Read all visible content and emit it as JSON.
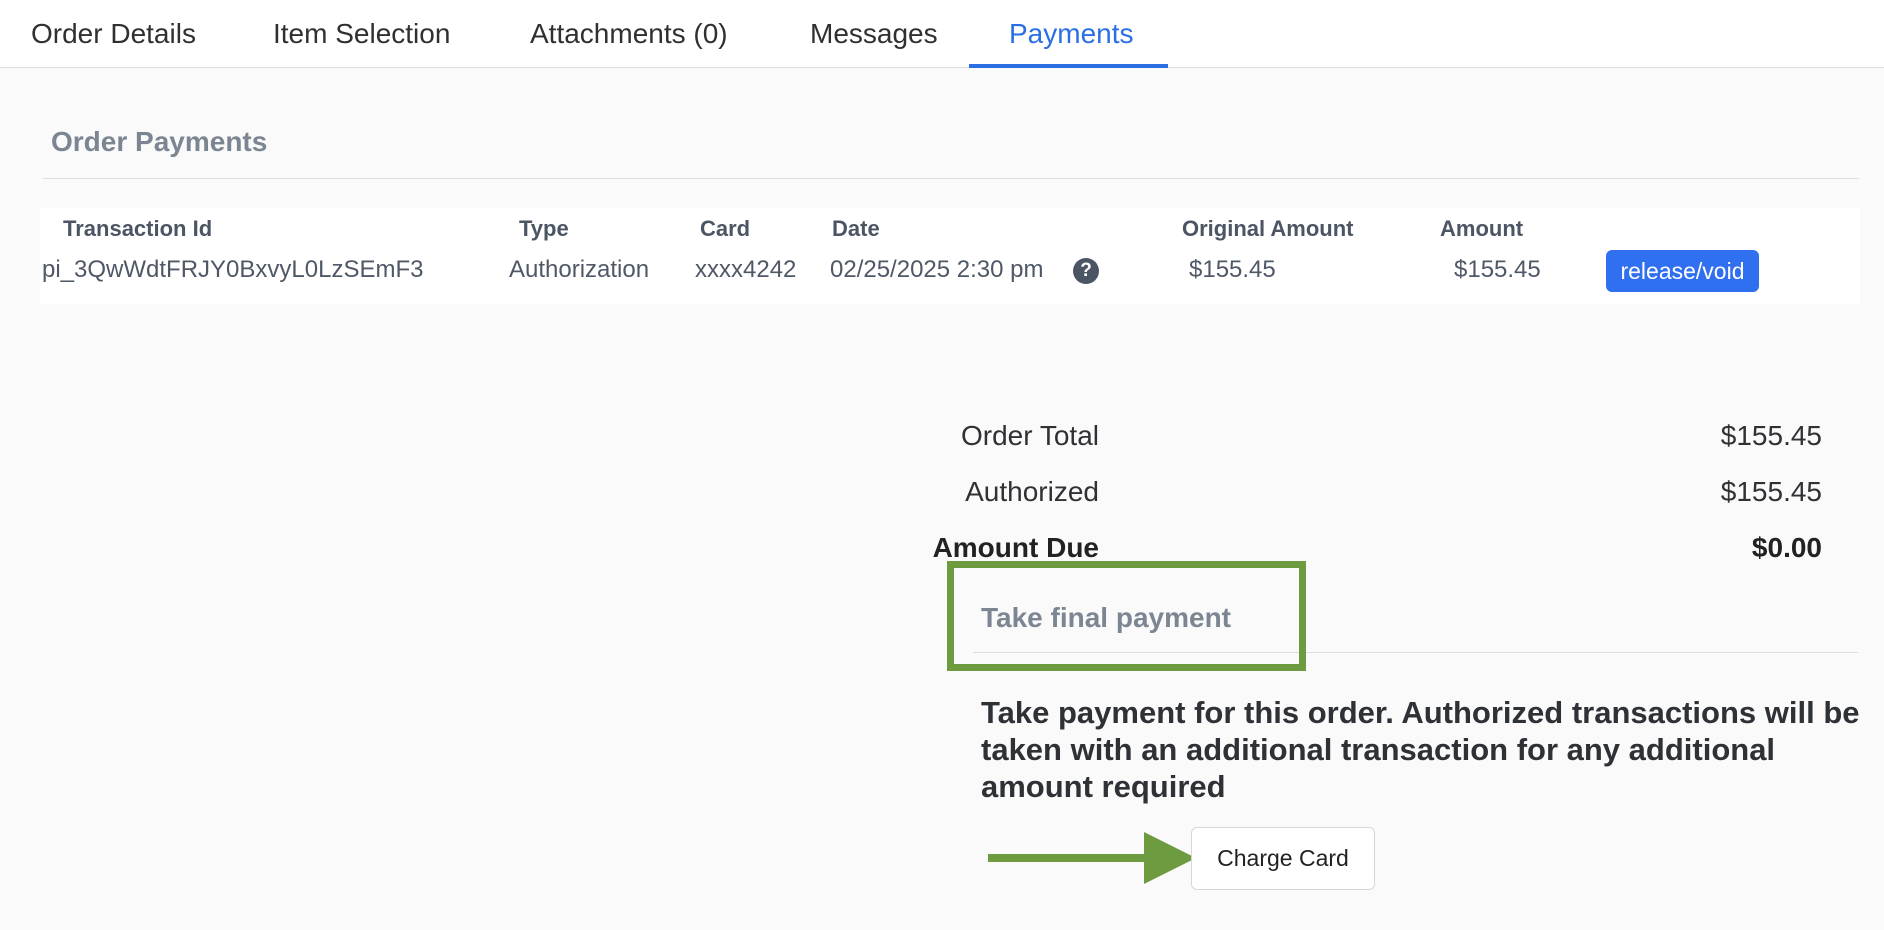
{
  "tabs": [
    {
      "label": "Order Details"
    },
    {
      "label": "Item Selection"
    },
    {
      "label": "Attachments (0)"
    },
    {
      "label": "Messages"
    },
    {
      "label": "Payments"
    }
  ],
  "order_payments": {
    "title": "Order Payments",
    "headers": {
      "transaction_id": "Transaction Id",
      "type": "Type",
      "card": "Card",
      "date": "Date",
      "original_amount": "Original Amount",
      "amount": "Amount"
    },
    "rows": [
      {
        "transaction_id": "pi_3QwWdtFRJY0BxvyL0LzSEmF3",
        "type": "Authorization",
        "card": "xxxx4242",
        "date": "02/25/2025 2:30 pm",
        "help_glyph": "?",
        "original_amount": "$155.45",
        "amount": "$155.45",
        "action_label": "release/void"
      }
    ]
  },
  "totals": {
    "order_total_label": "Order Total",
    "order_total_value": "$155.45",
    "authorized_label": "Authorized",
    "authorized_value": "$155.45",
    "amount_due_label": "Amount Due",
    "amount_due_value": "$0.00"
  },
  "final_payment": {
    "title": "Take final payment",
    "description": "Take payment for this order. Authorized transactions will be taken with an additional transaction for any additional amount required",
    "button_label": "Charge Card"
  },
  "icons": {
    "help": "question-circle-icon",
    "arrow": "arrow-right-icon"
  },
  "colors": {
    "accent": "#2a6fe3",
    "void_button": "#2f6ff0",
    "annotation": "#6e9b3f"
  }
}
